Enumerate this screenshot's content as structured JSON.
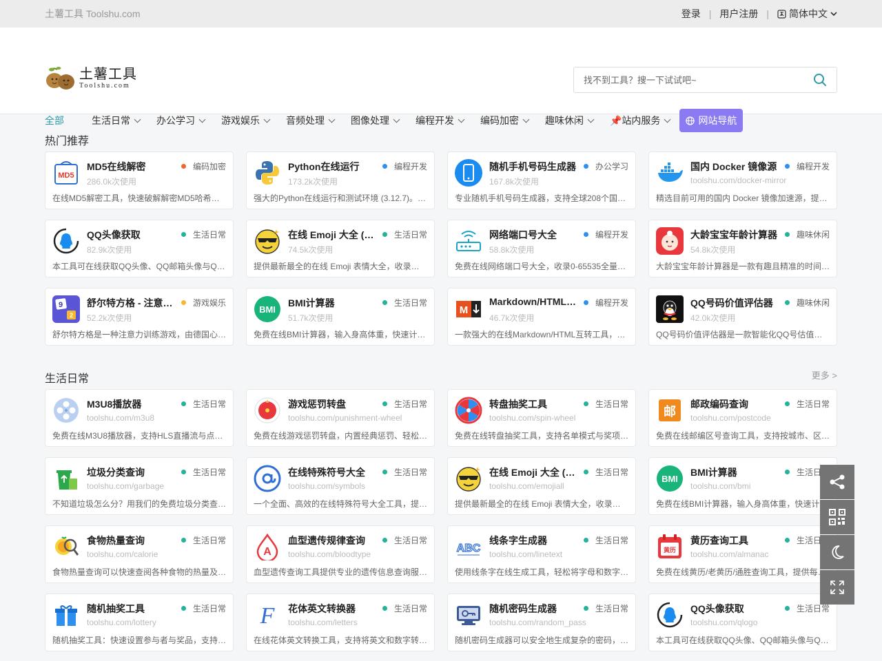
{
  "topbar": {
    "site_title": "土薯工具 Toolshu.com",
    "login": "登录",
    "register": "用户注册",
    "language": "简体中文"
  },
  "logo": {
    "name": "土薯工具",
    "domain": "Toolshu.com"
  },
  "search": {
    "placeholder": "找不到工具？搜一下试试吧~"
  },
  "nav": {
    "items": [
      "全部",
      "生活日常",
      "办公学习",
      "游戏娱乐",
      "音频处理",
      "图像处理",
      "编程开发",
      "编码加密",
      "趣味休闲",
      "📌站内服务"
    ],
    "site_nav": "网站导航"
  },
  "colors": {
    "accent": "#2d9aa8",
    "site_nav_bg": "#8b7bf2",
    "dot_orange": "#f0662e",
    "dot_blue": "#2f8ff0",
    "dot_teal": "#22b39a",
    "dot_yellow": "#f5b82e"
  },
  "hot": {
    "title": "热门推荐",
    "cards": [
      {
        "title": "MD5在线解密",
        "tag": "编码加密",
        "sub": "286.0k次使用",
        "desc": "在线MD5解密工具，快速破解解密MD5哈希…",
        "icon": "md5-icon",
        "dot": "#f0662e"
      },
      {
        "title": "Python在线运行",
        "tag": "编程开发",
        "sub": "173.2k次使用",
        "desc": "强大的Python在线运行和测试环境 (3.12.7)。…",
        "icon": "python-icon",
        "dot": "#2f8ff0"
      },
      {
        "title": "随机手机号码生成器",
        "tag": "办公学习",
        "sub": "167.8k次使用",
        "desc": "专业随机手机号码生成器，支持全球208个国…",
        "icon": "phone-icon",
        "dot": "#2f8ff0"
      },
      {
        "title": "国内 Docker 镜像源",
        "tag": "编程开发",
        "sub": "toolshu.com/docker-mirror",
        "desc": "精选目前可用的国内 Docker 镜像加速源，提…",
        "icon": "docker-icon",
        "dot": "#2f8ff0"
      },
      {
        "title": "QQ头像获取",
        "tag": "生活日常",
        "sub": "82.9k次使用",
        "desc": "本工具可在线获取QQ头像、QQ邮箱头像与Q…",
        "icon": "qq-avatar-icon",
        "dot": "#22b39a"
      },
      {
        "title": "在线 Emoji 大全 (…",
        "tag": "生活日常",
        "sub": "74.5k次使用",
        "desc": "提供最新最全的在线 Emoji 表情大全，收录…",
        "icon": "emoji-icon",
        "dot": "#22b39a"
      },
      {
        "title": "网络端口号大全",
        "tag": "编程开发",
        "sub": "58.8k次使用",
        "desc": "免费在线网络端口号大全，收录0-65535全量…",
        "icon": "router-icon",
        "dot": "#2f8ff0"
      },
      {
        "title": "大龄宝宝年龄计算器",
        "tag": "趣味休闲",
        "sub": "54.8k次使用",
        "desc": "大龄宝宝年龄计算器是一款有趣且精准的时间…",
        "icon": "baby-icon",
        "dot": "#22b39a"
      },
      {
        "title": "舒尔特方格 - 注意…",
        "tag": "游戏娱乐",
        "sub": "52.2k次使用",
        "desc": "舒尔特方格是一种注意力训练游戏，由德国心…",
        "icon": "schulte-grid-icon",
        "dot": "#f5b82e"
      },
      {
        "title": "BMI计算器",
        "tag": "生活日常",
        "sub": "51.7k次使用",
        "desc": "免费在线BMI计算器，输入身高体重，快速计…",
        "icon": "bmi-icon",
        "dot": "#22b39a"
      },
      {
        "title": "Markdown/HTML…",
        "tag": "编程开发",
        "sub": "46.7k次使用",
        "desc": "一款强大的在线Markdown/HTML互转工具，…",
        "icon": "markdown-icon",
        "dot": "#2f8ff0"
      },
      {
        "title": "QQ号码价值评估器",
        "tag": "趣味休闲",
        "sub": "42.0k次使用",
        "desc": "QQ号码价值评估器是一款智能化QQ号估值…",
        "icon": "qq-penguin-icon",
        "dot": "#22b39a"
      }
    ]
  },
  "daily": {
    "title": "生活日常",
    "more": "更多 >",
    "cards": [
      {
        "title": "M3U8播放器",
        "tag": "生活日常",
        "sub": "toolshu.com/m3u8",
        "desc": "免费在线M3U8播放器，支持HLS直播流与点…",
        "icon": "film-reel-icon",
        "dot": "#22b39a"
      },
      {
        "title": "游戏惩罚转盘",
        "tag": "生活日常",
        "sub": "toolshu.com/punishment-wheel",
        "desc": "免费在线游戏惩罚转盘，内置经典惩罚、轻松…",
        "icon": "punish-wheel-icon",
        "dot": "#22b39a"
      },
      {
        "title": "转盘抽奖工具",
        "tag": "生活日常",
        "sub": "toolshu.com/spin-wheel",
        "desc": "免费在线转盘抽奖工具，支持名单模式与奖项…",
        "icon": "spin-wheel-icon",
        "dot": "#22b39a"
      },
      {
        "title": "邮政编码查询",
        "tag": "生活日常",
        "sub": "toolshu.com/postcode",
        "desc": "免费在线邮编区号查询工具，支持按城市、区…",
        "icon": "postcode-icon",
        "dot": "#22b39a"
      },
      {
        "title": "垃圾分类查询",
        "tag": "生活日常",
        "sub": "toolshu.com/garbage",
        "desc": "不知道垃圾怎么分？用我们的免费垃圾分类查…",
        "icon": "recycle-bin-icon",
        "dot": "#22b39a"
      },
      {
        "title": "在线特殊符号大全",
        "tag": "生活日常",
        "sub": "toolshu.com/symbols",
        "desc": "一个全面、高效的在线特殊符号大全工具，提…",
        "icon": "at-symbol-icon",
        "dot": "#22b39a"
      },
      {
        "title": "在线 Emoji 大全 (…",
        "tag": "生活日常",
        "sub": "toolshu.com/emojiall",
        "desc": "提供最新最全的在线 Emoji 表情大全，收录…",
        "icon": "emoji-icon",
        "dot": "#22b39a"
      },
      {
        "title": "BMI计算器",
        "tag": "生活日常",
        "sub": "toolshu.com/bmi",
        "desc": "免费在线BMI计算器，输入身高体重，快速计…",
        "icon": "bmi-icon",
        "dot": "#22b39a"
      },
      {
        "title": "食物热量查询",
        "tag": "生活日常",
        "sub": "toolshu.com/calorie",
        "desc": "食物热量查询可以快速查阅各种食物的热量及…",
        "icon": "food-calorie-icon",
        "dot": "#22b39a"
      },
      {
        "title": "血型遗传规律查询",
        "tag": "生活日常",
        "sub": "toolshu.com/bloodtype",
        "desc": "血型遗传查询工具提供专业的遗传信息查询服…",
        "icon": "blood-type-icon",
        "dot": "#22b39a"
      },
      {
        "title": "线条字生成器",
        "tag": "生活日常",
        "sub": "toolshu.com/linetext",
        "desc": "使用线条字在线生成工具，轻松将字母和数字…",
        "icon": "line-text-icon",
        "dot": "#22b39a"
      },
      {
        "title": "黄历查询工具",
        "tag": "生活日常",
        "sub": "toolshu.com/almanac",
        "desc": "免费在线黄历/老黄历/通胜查询工具，提供每…",
        "icon": "almanac-icon",
        "dot": "#22b39a"
      },
      {
        "title": "随机抽奖工具",
        "tag": "生活日常",
        "sub": "toolshu.com/lottery",
        "desc": "随机抽奖工具：快速设置参与者与奖品，支持…",
        "icon": "gift-icon",
        "dot": "#22b39a"
      },
      {
        "title": "花体英文转换器",
        "tag": "生活日常",
        "sub": "toolshu.com/letters",
        "desc": "在线花体英文转换工具，支持将英文和数字转…",
        "icon": "fancy-f-icon",
        "dot": "#22b39a"
      },
      {
        "title": "随机密码生成器",
        "tag": "生活日常",
        "sub": "toolshu.com/random_pass",
        "desc": "随机密码生成器可以安全地生成复杂的密码，…",
        "icon": "password-icon",
        "dot": "#22b39a"
      },
      {
        "title": "QQ头像获取",
        "tag": "生活日常",
        "sub": "toolshu.com/qlogo",
        "desc": "本工具可在线获取QQ头像、QQ邮箱头像与Q…",
        "icon": "qq-avatar-icon",
        "dot": "#22b39a"
      }
    ]
  },
  "side_tools": [
    "share-icon",
    "qrcode-icon",
    "dark-mode-icon",
    "fullscreen-icon"
  ]
}
